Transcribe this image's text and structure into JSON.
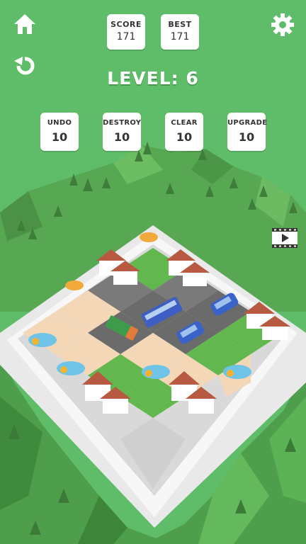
{
  "hud": {
    "score_label": "SCORE",
    "score_value": "171",
    "best_label": "BEST",
    "best_value": "171",
    "level_title": "LEVEL: 6"
  },
  "tools": [
    {
      "label": "UNDO",
      "count": "10"
    },
    {
      "label": "DESTROY",
      "count": "10"
    },
    {
      "label": "CLEAR",
      "count": "10"
    },
    {
      "label": "UPGRADE",
      "count": "10"
    }
  ],
  "icons": {
    "home": "home-icon",
    "settings": "gear-icon",
    "restart": "restart-icon",
    "video_ad": "video-reward-icon"
  },
  "colors": {
    "sky": "#5fbd6a",
    "hill": "#4e9a4a",
    "board": "#f2f2f2",
    "road": "#6b6b6b",
    "grass": "#62b84f",
    "sand": "#f3d7b7",
    "roof": "#b85a42",
    "bus": "#3d5fc4"
  }
}
